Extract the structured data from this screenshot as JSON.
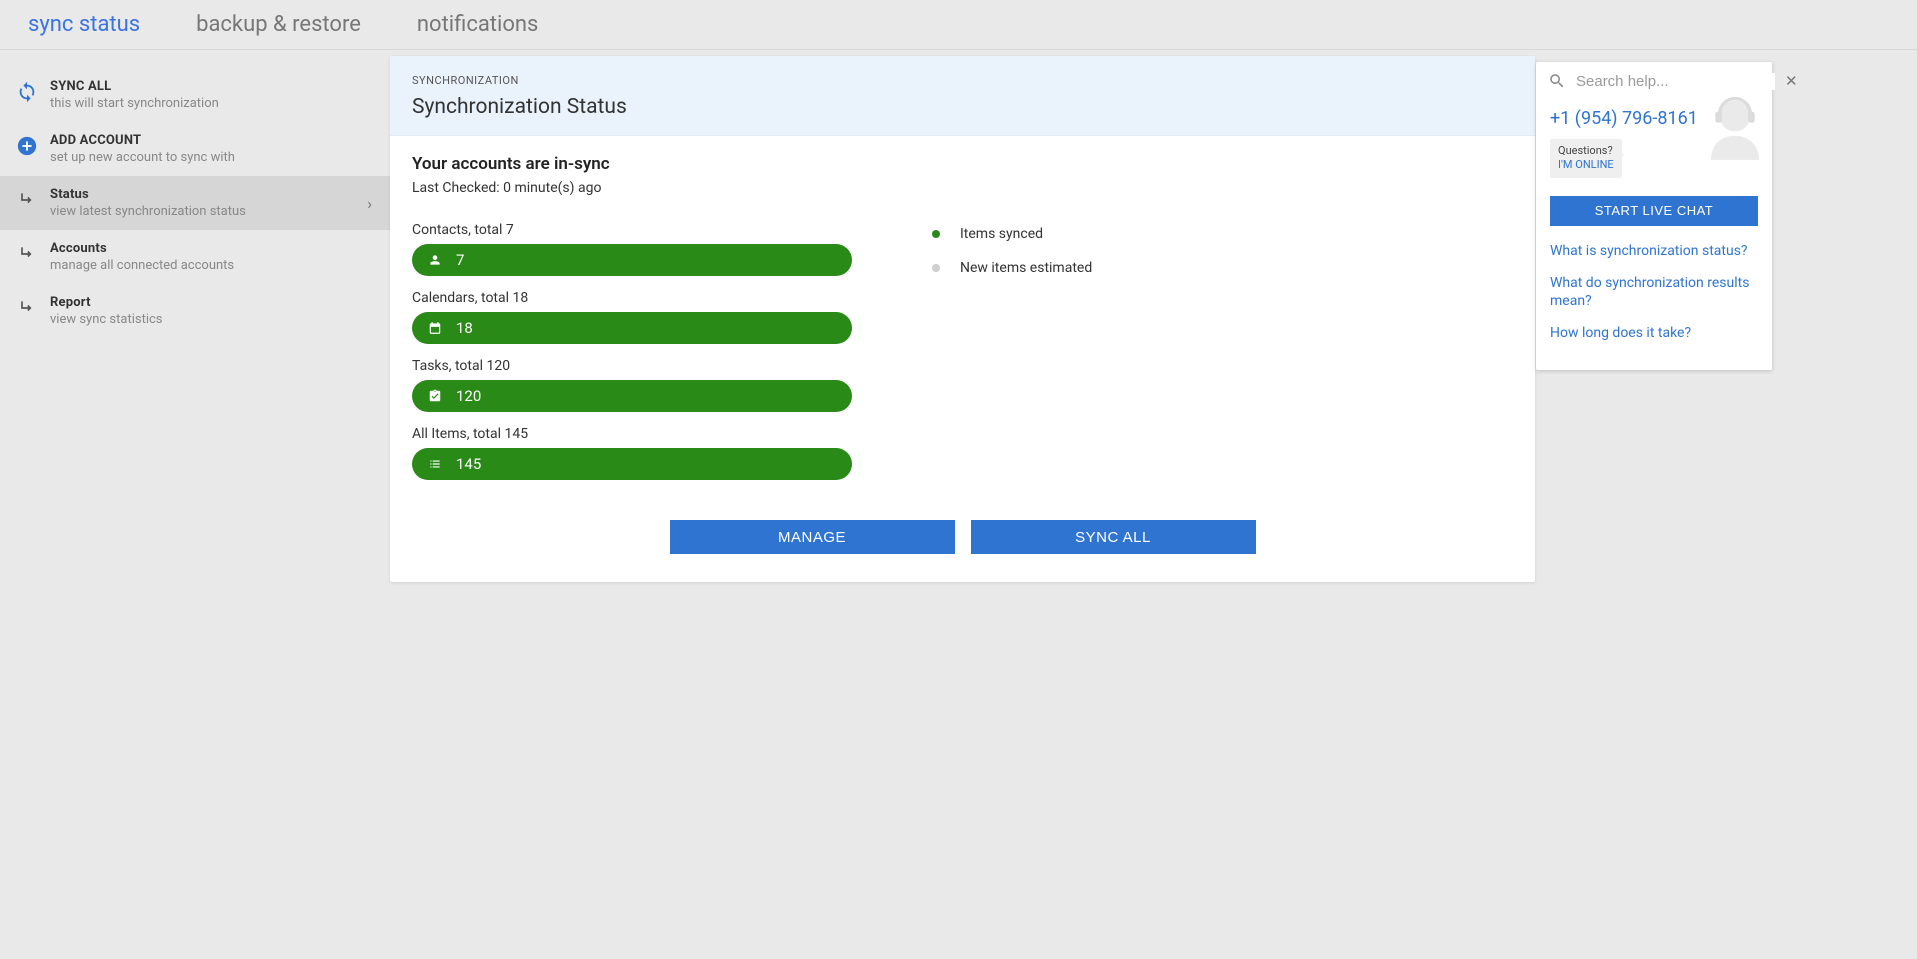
{
  "tabs": {
    "sync": "sync status",
    "backup": "backup & restore",
    "notifications": "notifications"
  },
  "sidebar": {
    "syncAll": {
      "title": "SYNC ALL",
      "sub": "this will start synchronization"
    },
    "addAccount": {
      "title": "ADD ACCOUNT",
      "sub": "set up new account to sync with"
    },
    "status": {
      "title": "Status",
      "sub": "view latest synchronization status"
    },
    "accounts": {
      "title": "Accounts",
      "sub": "manage all connected accounts"
    },
    "report": {
      "title": "Report",
      "sub": "view sync statistics"
    }
  },
  "card": {
    "eyebrow": "SYNCHRONIZATION",
    "title": "Synchronization Status"
  },
  "status": {
    "headline": "Your accounts are in-sync",
    "lastChecked": "Last Checked: 0 minute(s) ago"
  },
  "bars": {
    "contacts": {
      "label": "Contacts, total 7",
      "value": "7"
    },
    "calendars": {
      "label": "Calendars, total 18",
      "value": "18"
    },
    "tasks": {
      "label": "Tasks, total 120",
      "value": "120"
    },
    "all": {
      "label": "All Items, total 145",
      "value": "145"
    }
  },
  "legend": {
    "synced": "Items synced",
    "estimated": "New items estimated"
  },
  "buttons": {
    "manage": "MANAGE",
    "syncAll": "SYNC ALL"
  },
  "help": {
    "searchPlaceholder": "Search help...",
    "phone": "+1 (954) 796-8161",
    "bubbleQuestion": "Questions?",
    "bubbleOnline": "I'M ONLINE",
    "chatBtn": "START LIVE CHAT",
    "links": {
      "l1": "What is synchronization status?",
      "l2": "What do synchronization results mean?",
      "l3": "How long does it take?"
    }
  }
}
